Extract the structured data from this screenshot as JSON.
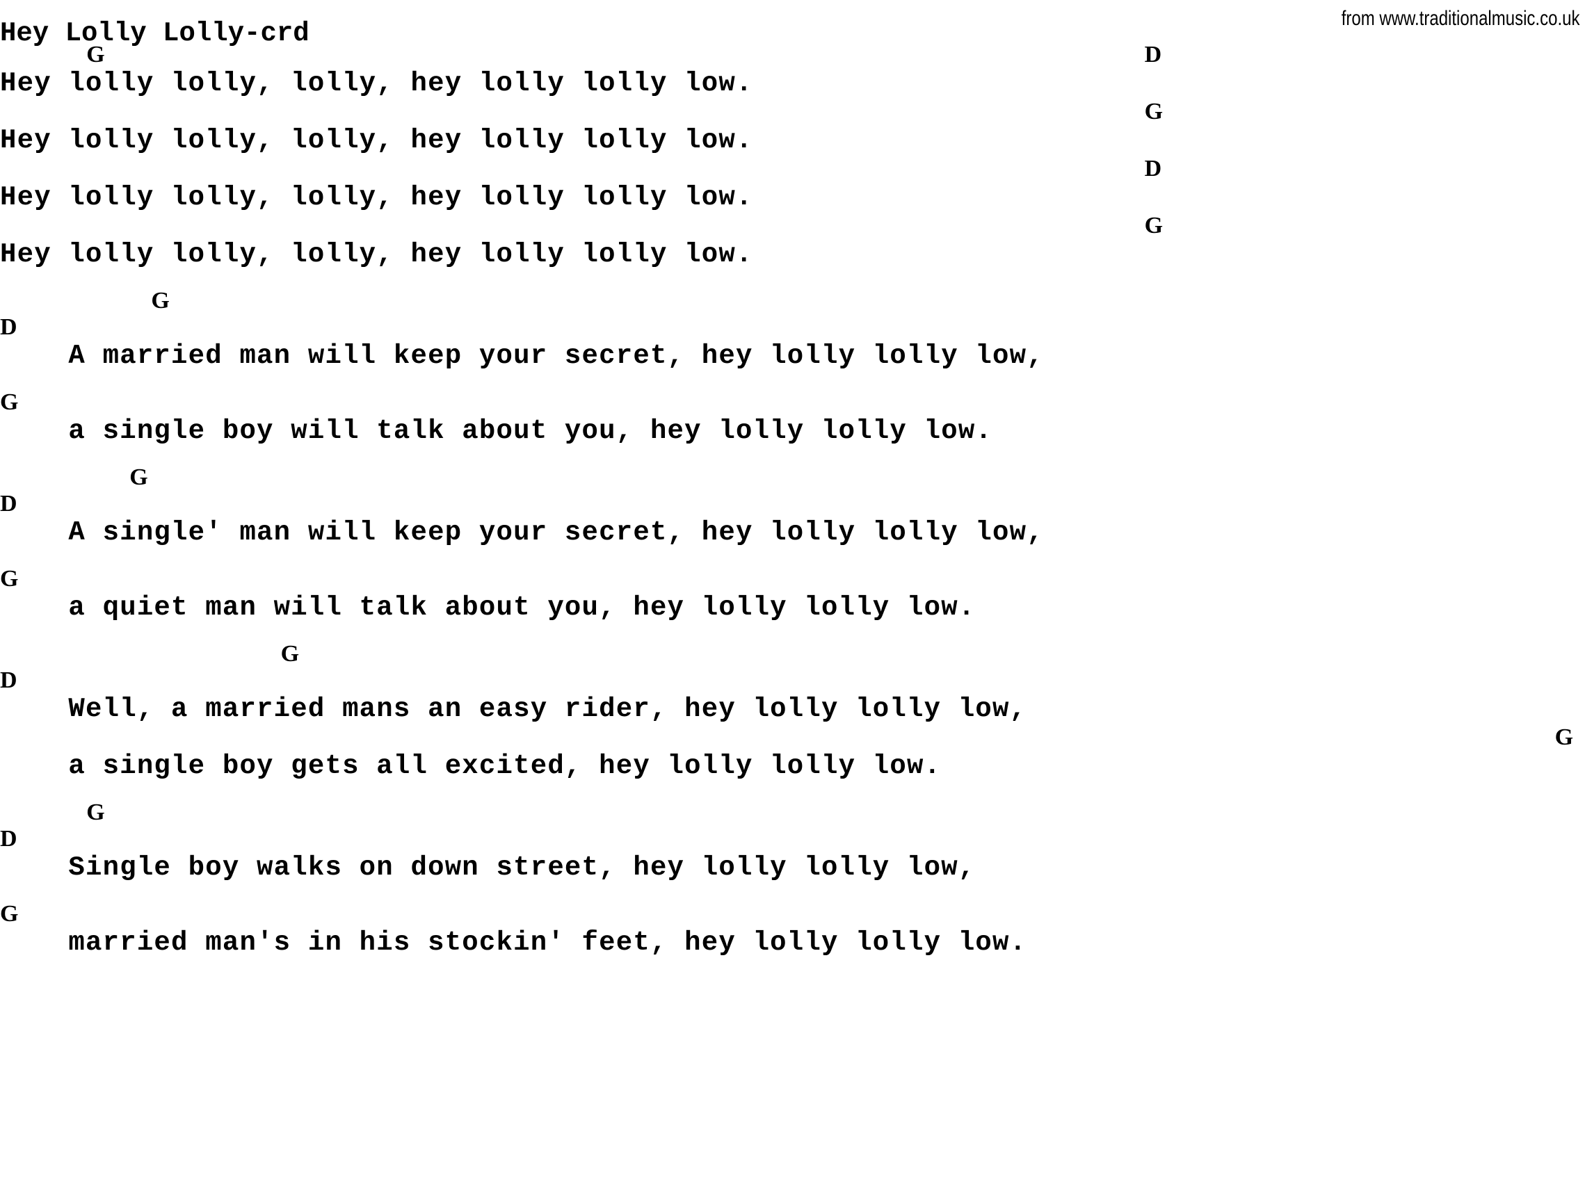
{
  "page": {
    "title": "Hey Lolly Lolly-crd",
    "attribution": "from www.traditionalmusic.co.uk",
    "background_color": "#ffffff",
    "text_color": "#000000"
  },
  "chords_used": [
    "G",
    "D"
  ],
  "lines": [
    {
      "kind": "chord",
      "cells": [
        {
          "col": 4,
          "text": "G"
        },
        {
          "col": 53,
          "text": "D"
        }
      ]
    },
    {
      "kind": "lyric",
      "text": "Hey lolly lolly, lolly, hey lolly lolly low."
    },
    {
      "kind": "chord",
      "cells": [
        {
          "col": 53,
          "text": "G"
        }
      ]
    },
    {
      "kind": "lyric",
      "text": "Hey lolly lolly, lolly, hey lolly lolly low."
    },
    {
      "kind": "chord",
      "cells": [
        {
          "col": 53,
          "text": "D"
        }
      ]
    },
    {
      "kind": "lyric",
      "text": "Hey lolly lolly, lolly, hey lolly lolly low."
    },
    {
      "kind": "chord",
      "cells": [
        {
          "col": 53,
          "text": "G"
        }
      ]
    },
    {
      "kind": "lyric",
      "text": "Hey lolly lolly, lolly, hey lolly lolly low."
    },
    {
      "kind": "blank"
    },
    {
      "kind": "chord",
      "cells": [
        {
          "col": 7,
          "text": "G"
        }
      ]
    },
    {
      "kind": "chord",
      "cells": [
        {
          "col": 0,
          "text": "D"
        }
      ]
    },
    {
      "kind": "lyric",
      "text": "    A married man will keep your secret, hey lolly lolly low,"
    },
    {
      "kind": "blank"
    },
    {
      "kind": "chord",
      "cells": [
        {
          "col": 0,
          "text": "G"
        }
      ]
    },
    {
      "kind": "lyric",
      "text": "    a single boy will talk about you, hey lolly lolly low."
    },
    {
      "kind": "blank"
    },
    {
      "kind": "chord",
      "cells": [
        {
          "col": 6,
          "text": "G"
        }
      ]
    },
    {
      "kind": "chord",
      "cells": [
        {
          "col": 0,
          "text": "D"
        }
      ]
    },
    {
      "kind": "lyric",
      "text": "    A single' man will keep your secret, hey lolly lolly low,"
    },
    {
      "kind": "blank"
    },
    {
      "kind": "chord",
      "cells": [
        {
          "col": 0,
          "text": "G"
        }
      ]
    },
    {
      "kind": "lyric",
      "text": "    a quiet man will talk about you, hey lolly lolly low."
    },
    {
      "kind": "blank"
    },
    {
      "kind": "chord",
      "cells": [
        {
          "col": 13,
          "text": "G"
        }
      ]
    },
    {
      "kind": "chord",
      "cells": [
        {
          "col": 0,
          "text": "D"
        }
      ]
    },
    {
      "kind": "lyric",
      "text": "    Well, a married mans an easy rider, hey lolly lolly low,"
    },
    {
      "kind": "chord",
      "cells": [
        {
          "col": 72,
          "text": "G"
        }
      ]
    },
    {
      "kind": "lyric",
      "text": "    a single boy gets all excited, hey lolly lolly low."
    },
    {
      "kind": "blank"
    },
    {
      "kind": "chord",
      "cells": [
        {
          "col": 4,
          "text": "G"
        }
      ]
    },
    {
      "kind": "chord",
      "cells": [
        {
          "col": 0,
          "text": "D"
        }
      ]
    },
    {
      "kind": "lyric",
      "text": "    Single boy walks on down street, hey lolly lolly low,"
    },
    {
      "kind": "blank"
    },
    {
      "kind": "chord",
      "cells": [
        {
          "col": 0,
          "text": "G"
        }
      ]
    },
    {
      "kind": "lyric",
      "text": "    married man's in his stockin' feet, hey lolly lolly low."
    }
  ]
}
